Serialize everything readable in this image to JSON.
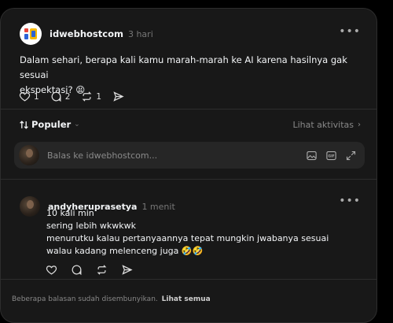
{
  "post": {
    "username": "idwebhostcom",
    "time": "3 hari",
    "text_line1": "Dalam sehari, berapa kali kamu marah-marah ke AI karena hasilnya gak sesuai",
    "text_line2": "ekspektasi? 😫",
    "likes": "1",
    "comments": "2",
    "reposts": "1"
  },
  "sort": {
    "label": "Populer",
    "activity_label": "Lihat aktivitas"
  },
  "reply": {
    "placeholder": "Balas ke idwebhostcom..."
  },
  "comment": {
    "username": "andyheruprasetya",
    "time": "1 menit",
    "lines": [
      "10 kali min",
      "sering lebih wkwkwk",
      "menurutku kalau pertanyaannya tepat mungkin jwabanya sesuai",
      "walau kadang melenceng juga 🤣🤣"
    ]
  },
  "footer": {
    "note": "Beberapa balasan sudah disembunyikan.",
    "link": "Lihat semua"
  },
  "icons": [
    "idwebhost-logo",
    "more-icon",
    "heart-icon",
    "comment-icon",
    "repost-icon",
    "share-icon",
    "sort-icon",
    "chevron-down-icon",
    "chevron-right-icon",
    "image-icon",
    "gif-icon",
    "expand-icon"
  ],
  "colors": {
    "background": "#000000",
    "card": "#181818",
    "input": "#262626",
    "text": "#f3f5f7",
    "muted": "#777777"
  }
}
